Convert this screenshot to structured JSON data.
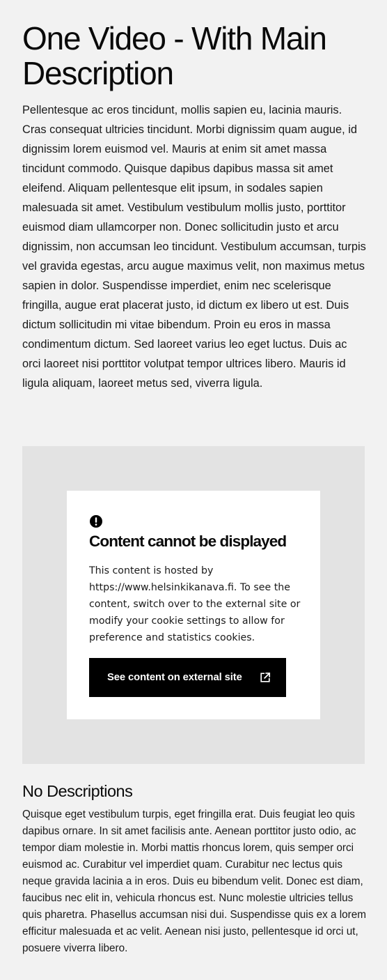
{
  "header": {
    "title": "One Video - With Main Description",
    "description": "Pellentesque ac eros tincidunt, mollis sapien eu, lacinia mauris. Cras consequat ultricies tincidunt. Morbi dignissim quam augue, id dignissim lorem euismod vel. Mauris at enim sit amet massa tincidunt commodo. Quisque dapibus dapibus massa sit amet eleifend. Aliquam pellentesque elit ipsum, in sodales sapien malesuada sit amet. Vestibulum vestibulum mollis justo, porttitor euismod diam ullamcorper non. Donec sollicitudin justo et arcu dignissim, non accumsan leo tincidunt. Vestibulum accumsan, turpis vel gravida egestas, arcu augue maximus velit, non maximus metus sapien in dolor. Suspendisse imperdiet, enim nec scelerisque fringilla, augue erat placerat justo, id dictum ex libero ut est. Duis dictum sollicitudin mi vitae bibendum. Proin eu eros in massa condimentum dictum. Sed laoreet varius leo eget luctus. Duis ac orci laoreet nisi porttitor volutpat tempor ultrices libero. Mauris id ligula aliquam, laoreet metus sed, viverra ligula."
  },
  "video_consent": {
    "icon": "alert-circle-icon",
    "title": "Content cannot be displayed",
    "text": "This content is hosted by https://www.helsinkikanava.fi. To see the content, switch over to the external site or modify your cookie settings to allow for preference and statistics cookies.",
    "button_label": "See content on external site",
    "button_icon": "link-external-icon"
  },
  "no_descriptions": {
    "title": "No Descriptions",
    "text": "Quisque eget vestibulum turpis, eget fringilla erat. Duis feugiat leo quis dapibus ornare. In sit amet facilisis ante. Aenean porttitor justo odio, ac tempor diam molestie in. Morbi mattis rhoncus lorem, quis semper orci euismod ac. Curabitur vel imperdiet quam. Curabitur nec lectus quis neque gravida lacinia a in eros. Duis eu bibendum velit. Donec est diam, faucibus nec elit in, vehicula rhoncus est. Nunc molestie ultricies tellus quis pharetra. Phasellus accumsan nisi dui. Suspendisse quis ex a lorem efficitur malesuada et ac velit. Aenean nisi justo, pellentesque id orci ut, posuere viverra libero."
  },
  "colors": {
    "page_background": "#f2f2f2",
    "video_placeholder_background": "#e3e3e3",
    "card_background": "#ffffff",
    "button_background": "#000000",
    "button_text": "#ffffff"
  }
}
